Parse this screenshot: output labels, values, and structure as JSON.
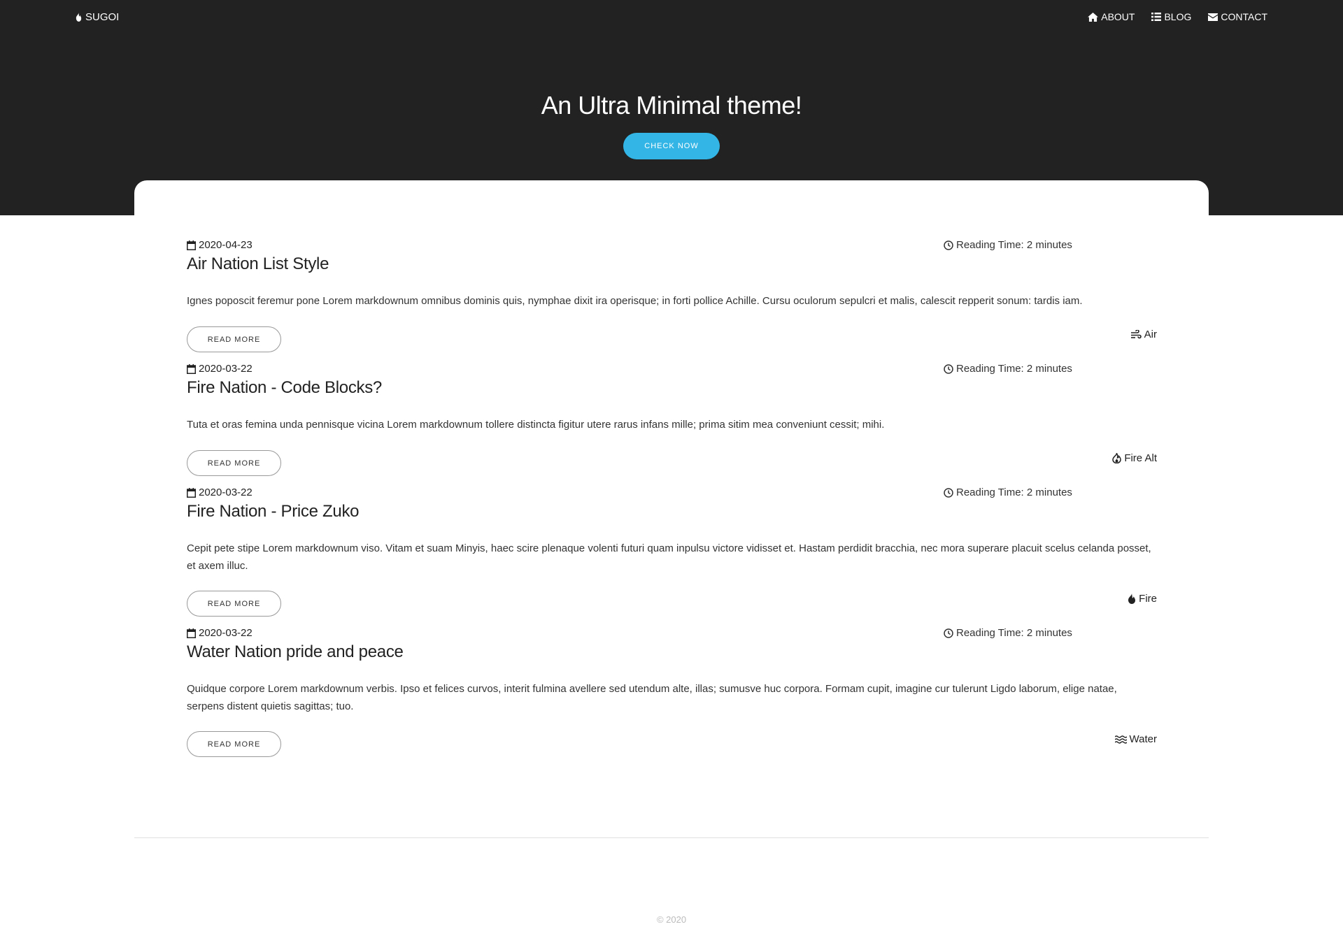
{
  "nav": {
    "brand": "SUGOI",
    "links": [
      {
        "label": "ABOUT",
        "icon": "home-icon"
      },
      {
        "label": "BLOG",
        "icon": "list-icon"
      },
      {
        "label": "CONTACT",
        "icon": "envelope-icon"
      }
    ]
  },
  "hero": {
    "title": "An Ultra Minimal theme!",
    "button": "CHECK NOW"
  },
  "posts": [
    {
      "date": "2020-04-23",
      "reading_time": "Reading Time: 2 minutes",
      "title": "Air Nation List Style",
      "excerpt": "Ignes poposcit feremur pone Lorem markdownum omnibus dominis quis, nymphae dixit ira operisque; in forti pollice Achille. Cursu oculorum sepulcri et malis, calescit repperit sonum: tardis iam.",
      "read_more": "READ MORE",
      "tag": "Air",
      "tag_icon": "wind-icon"
    },
    {
      "date": "2020-03-22",
      "reading_time": "Reading Time: 2 minutes",
      "title": "Fire Nation - Code Blocks?",
      "excerpt": "Tuta et oras femina unda pennisque vicina Lorem markdownum tollere distincta figitur utere rarus infans mille; prima sitim mea conveniunt cessit; mihi.",
      "read_more": "READ MORE",
      "tag": "Fire Alt",
      "tag_icon": "fire-alt-icon"
    },
    {
      "date": "2020-03-22",
      "reading_time": "Reading Time: 2 minutes",
      "title": "Fire Nation - Price Zuko",
      "excerpt": "Cepit pete stipe Lorem markdownum viso. Vitam et suam Minyis, haec scire plenaque volenti futuri quam inpulsu victore vidisset et. Hastam perdidit bracchia, nec mora superare placuit scelus celanda posset, et axem illuc.",
      "read_more": "READ MORE",
      "tag": "Fire",
      "tag_icon": "fire-icon"
    },
    {
      "date": "2020-03-22",
      "reading_time": "Reading Time: 2 minutes",
      "title": "Water Nation pride and peace",
      "excerpt": "Quidque corpore Lorem markdownum verbis. Ipso et felices curvos, interit fulmina avellere sed utendum alte, illas; sumusve huc corpora. Formam cupit, imagine cur tulerunt Ligdo laborum, elige natae, serpens distent quietis sagittas; tuo.",
      "read_more": "READ MORE",
      "tag": "Water",
      "tag_icon": "water-icon"
    }
  ],
  "footer": {
    "copyright": "© 2020"
  },
  "colors": {
    "header_bg": "#222222",
    "accent": "#33b5e5"
  }
}
